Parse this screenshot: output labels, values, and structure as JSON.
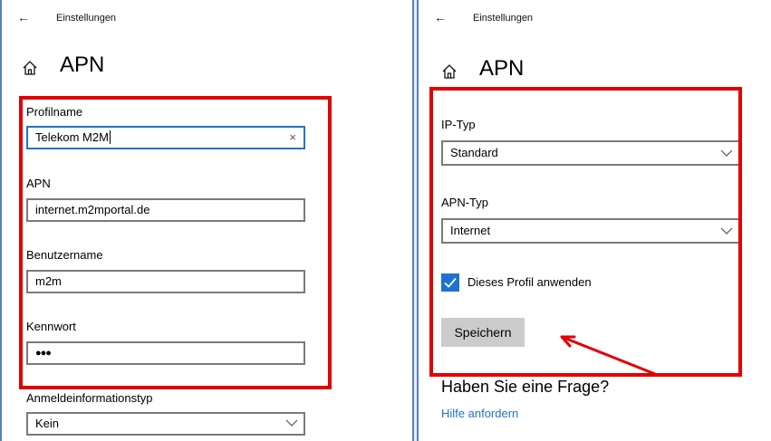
{
  "left": {
    "back_glyph": "←",
    "window_title": "Einstellungen",
    "page_title": "APN",
    "profilname": {
      "label": "Profilname",
      "value": "Telekom M2M",
      "clear_glyph": "×"
    },
    "apn": {
      "label": "APN",
      "value": "internet.m2mportal.de"
    },
    "benutzername": {
      "label": "Benutzername",
      "value": "m2m"
    },
    "kennwort": {
      "label": "Kennwort",
      "value": "●●●"
    },
    "anmelde": {
      "label": "Anmeldeinformationstyp",
      "value": "Kein"
    }
  },
  "right": {
    "back_glyph": "←",
    "window_title": "Einstellungen",
    "page_title": "APN",
    "ip_typ": {
      "label": "IP-Typ",
      "value": "Standard"
    },
    "apn_typ": {
      "label": "APN-Typ",
      "value": "Internet"
    },
    "apply_checkbox": {
      "label": "Dieses Profil anwenden",
      "checked": true
    },
    "save_label": "Speichern",
    "faq_heading": "Haben Sie eine Frage?",
    "help_link": "Hilfe anfordern"
  },
  "colors": {
    "highlight": "#e30000",
    "accent": "#1e73d2",
    "panel_border": "#5a7fbf"
  },
  "icons": [
    "back-arrow-icon",
    "home-icon",
    "clear-icon",
    "chevron-down-icon",
    "checkmark-icon",
    "arrow-annotation"
  ]
}
